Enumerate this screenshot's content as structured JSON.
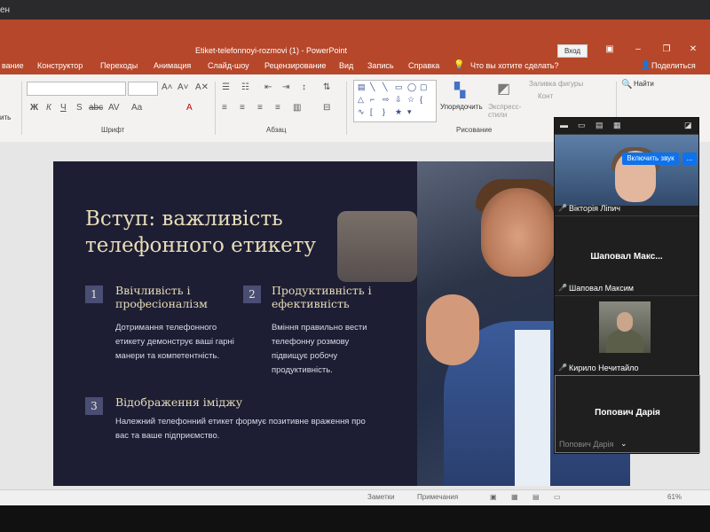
{
  "os": {
    "corner_text": "ен"
  },
  "window": {
    "doc_title": "Etiket-telefonnoyi-rozmovi (1)  -  PowerPoint",
    "signin": "Вход",
    "icons": [
      "ribbon-display-icon",
      "minimize-icon",
      "maximize-icon",
      "close-icon"
    ]
  },
  "tabs": {
    "items": [
      "вание",
      "Конструктор",
      "Переходы",
      "Анимация",
      "Слайд-шоу",
      "Рецензирование",
      "Вид",
      "Запись",
      "Справка"
    ],
    "search": "Что вы хотите сделать?",
    "share": "Поделиться"
  },
  "ribbon": {
    "groups": {
      "font": "Шрифт",
      "paragraph": "Абзац",
      "drawing": "Рисование"
    },
    "paste_label": "ить",
    "arrange": "Упорядочить",
    "quick_styles": "Экспресс-стили",
    "shape_fill": "Заливка фигуры",
    "shape_outline": "Конт",
    "find": "Найти",
    "font_buttons": [
      "Ж",
      "К",
      "Ч",
      "S",
      "abc",
      "AV",
      "Aa",
      "A"
    ]
  },
  "slide": {
    "title": "Вступ: важливість телефонного етикету",
    "items": [
      {
        "num": "1",
        "head": "Ввічливість і професіоналізм",
        "body": "Дотримання телефонного етикету демонструє ваші гарні манери та компетентність."
      },
      {
        "num": "2",
        "head": "Продуктивність і ефективність",
        "body": "Вміння правильно вести телефонну розмову підвищує робочу продуктивність."
      },
      {
        "num": "3",
        "head": "Відображення іміджу",
        "body": "Належний телефонний етикет формує позитивне враження про вас та ваше підприємство."
      }
    ]
  },
  "status": {
    "notes": "Заметки",
    "comments": "Примечания",
    "zoom": "61%"
  },
  "zoom": {
    "unmute": "Включить звук",
    "more": "...",
    "participants": [
      {
        "name": "Вікторія Ліпич"
      },
      {
        "center": "Шаповал  Макс...",
        "name": "Шаповал Максим"
      },
      {
        "name": "Кирило Нечитайло"
      },
      {
        "center": "Попович Дарія",
        "name": "Попович Дарія"
      }
    ]
  }
}
